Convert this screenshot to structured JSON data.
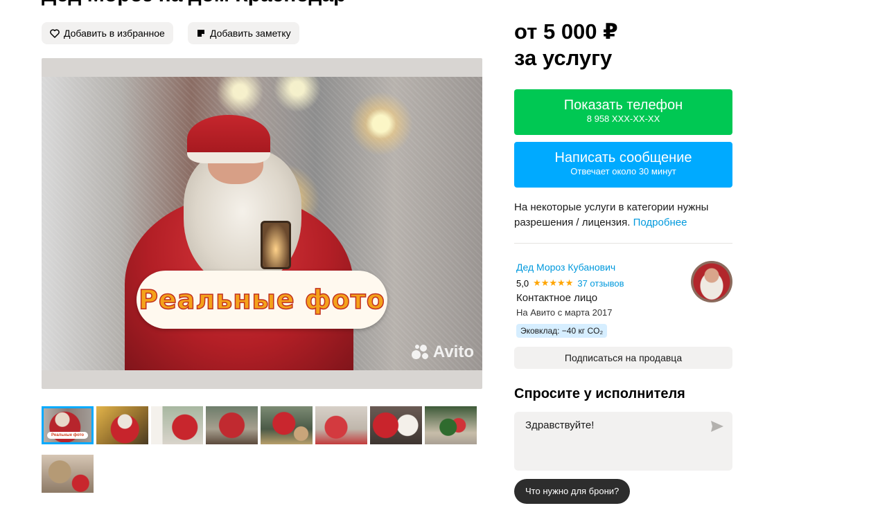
{
  "listing": {
    "title": "Дед Мороз на дом Краснодар"
  },
  "actions": {
    "favorite_label": "Добавить в избранное",
    "note_label": "Добавить заметку"
  },
  "gallery": {
    "badge_text": "Реальные фото",
    "watermark": "Avito",
    "thumbnails": [
      {
        "label": "Реальные фото"
      },
      {
        "label": ""
      },
      {
        "label": ""
      },
      {
        "label": ""
      },
      {
        "label": ""
      },
      {
        "label": ""
      },
      {
        "label": ""
      },
      {
        "label": ""
      },
      {
        "label": ""
      }
    ]
  },
  "price": {
    "line1": "от 5 000 ₽",
    "line2": "за услугу"
  },
  "phone_button": {
    "label": "Показать телефон",
    "sub": "8 958 XXX-XX-XX"
  },
  "message_button": {
    "label": "Написать сообщение",
    "sub": "Отвечает около 30 минут"
  },
  "license": {
    "text": "На некоторые услуги в категории нужны разрешения / лицензия. ",
    "link": "Подробнее"
  },
  "seller": {
    "name": "Дед Мороз Кубанович",
    "rating": "5,0",
    "stars": "★★★★★",
    "reviews": "37 отзывов",
    "role": "Контактное лицо",
    "since": "На Авито с марта 2017",
    "eco": "Эковклад: −40 кг CO₂",
    "subscribe_label": "Подписаться на продавца"
  },
  "ask": {
    "title": "Спросите у исполнителя",
    "message": "Здравствуйте!",
    "quick_reply": "Что нужно для брони?"
  },
  "colors": {
    "green": "#00c853",
    "blue": "#00aaff",
    "link": "#0099dd"
  }
}
